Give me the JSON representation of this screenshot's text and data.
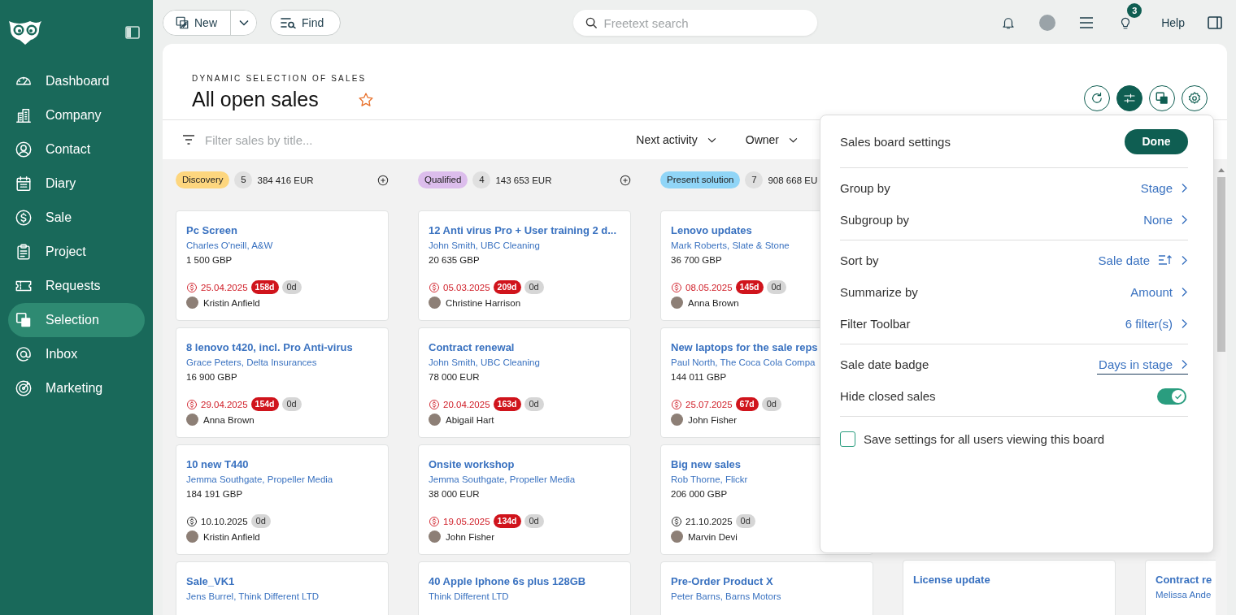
{
  "sidebar": {
    "items": [
      {
        "label": "Dashboard",
        "selected": false
      },
      {
        "label": "Company",
        "selected": false
      },
      {
        "label": "Contact",
        "selected": false
      },
      {
        "label": "Diary",
        "selected": false
      },
      {
        "label": "Sale",
        "selected": false
      },
      {
        "label": "Project",
        "selected": false
      },
      {
        "label": "Requests",
        "selected": false
      },
      {
        "label": "Selection",
        "selected": true
      },
      {
        "label": "Inbox",
        "selected": false
      },
      {
        "label": "Marketing",
        "selected": false
      }
    ]
  },
  "topbar": {
    "new_button": "New",
    "find_button": "Find",
    "search": {
      "placeholder": "Freetext search"
    },
    "notification_count": "3",
    "help": "Help"
  },
  "header": {
    "subtitle": "DYNAMIC SELECTION OF SALES",
    "title": "All open sales",
    "favorite": false,
    "tools": [
      {
        "selected": false
      },
      {
        "selected": true
      },
      {
        "selected": false
      },
      {
        "selected": false
      }
    ]
  },
  "filter_bar": {
    "placeholder": "Filter sales by title...",
    "dropdowns": [
      "Next activity",
      "Owner"
    ]
  },
  "board": {
    "columns": [
      {
        "stage": "Discovery",
        "color": "#fdd67e",
        "count": "5",
        "total": "384 416 EUR",
        "cards": [
          {
            "title": "Pc Screen",
            "contact": "Charles O'neill, A&W",
            "amount": "1 500 GBP",
            "date": "25.04.2025",
            "overdue": true,
            "badge": "158d",
            "days": "0d",
            "owner": "Kristin Anfield"
          },
          {
            "title": "8 lenovo t420, incl. Pro Anti-virus",
            "contact": "Grace Peters, Delta Insurances",
            "amount": "16 900 GBP",
            "date": "29.04.2025",
            "overdue": true,
            "badge": "154d",
            "days": "0d",
            "owner": "Anna Brown"
          },
          {
            "title": "10 new T440",
            "contact": "Jemma Southgate, Propeller Media",
            "amount": "184 191 GBP",
            "date": "10.10.2025",
            "overdue": false,
            "days": "0d",
            "owner": "Kristin Anfield"
          },
          {
            "title": "Sale_VK1",
            "contact": "Jens Burrel, Think Different LTD"
          }
        ]
      },
      {
        "stage": "Qualified",
        "color": "#dcbdec",
        "count": "4",
        "total": "143 653 EUR",
        "cards": [
          {
            "title": "12 Anti virus Pro + User training 2 d...",
            "contact": "John Smith, UBC Cleaning",
            "amount": "20 635 GBP",
            "date": "05.03.2025",
            "overdue": true,
            "badge": "209d",
            "days": "0d",
            "owner": "Christine Harrison"
          },
          {
            "title": "Contract renewal",
            "contact": "John Smith, UBC Cleaning",
            "amount": "78 000 EUR",
            "date": "20.04.2025",
            "overdue": true,
            "badge": "163d",
            "days": "0d",
            "owner": "Abigail Hart"
          },
          {
            "title": "Onsite workshop",
            "contact": "Jemma Southgate, Propeller Media",
            "amount": "38 000 EUR",
            "date": "19.05.2025",
            "overdue": true,
            "badge": "134d",
            "days": "0d",
            "owner": "John Fisher"
          },
          {
            "title": "40 Apple Iphone 6s plus 128GB",
            "contact": "Think Different LTD"
          }
        ]
      },
      {
        "stage": "Present solution",
        "color": "#90d5f7",
        "count": "7",
        "total": "908 668 EU",
        "cards": [
          {
            "title": "Lenovo updates",
            "contact": "Mark Roberts, Slate & Stone",
            "amount": "36 700 GBP",
            "date": "08.05.2025",
            "overdue": true,
            "badge": "145d",
            "days": "0d",
            "owner": "Anna Brown"
          },
          {
            "title": "New laptops for the sale reps",
            "contact": "Paul North, The Coca Cola Compa",
            "amount": "144 011 GBP",
            "date": "25.07.2025",
            "overdue": true,
            "badge": "67d",
            "days": "0d",
            "owner": "John Fisher"
          },
          {
            "title": "Big new sales",
            "contact": "Rob Thorne, Flickr",
            "amount": "206 000 GBP",
            "date": "21.10.2025",
            "overdue": false,
            "days": "0d",
            "owner": "Marvin Devi"
          },
          {
            "title": "Pre-Order Product X",
            "contact": "Peter Barns, Barns Motors"
          }
        ]
      },
      {
        "cards": [
          {
            "title": "License update"
          }
        ]
      },
      {
        "cards": [
          {
            "title": "Contract re",
            "contact": "Melissa Ande"
          }
        ]
      }
    ]
  },
  "settings": {
    "title": "Sales board settings",
    "done": "Done",
    "sections": [
      {
        "rows": [
          {
            "kind": "link",
            "label": "Group by",
            "value": "Stage",
            "focused": false
          },
          {
            "kind": "link",
            "label": "Subgroup by",
            "value": "None",
            "focused": false
          }
        ]
      },
      {
        "rows": [
          {
            "kind": "sort",
            "label": "Sort by",
            "value": "Sale date",
            "focused": false
          },
          {
            "kind": "link",
            "label": "Summarize by",
            "value": "Amount",
            "focused": false
          },
          {
            "kind": "link",
            "label": "Filter Toolbar",
            "value": "6 filter(s)",
            "focused": false
          }
        ]
      },
      {
        "rows": [
          {
            "kind": "link",
            "label": "Sale date badge",
            "value": "Days in stage",
            "focused": true
          },
          {
            "kind": "toggle",
            "label": "Hide closed sales",
            "on": true
          }
        ]
      }
    ],
    "save_for_all": {
      "label": "Save settings for all users viewing this board",
      "checked": false
    }
  }
}
